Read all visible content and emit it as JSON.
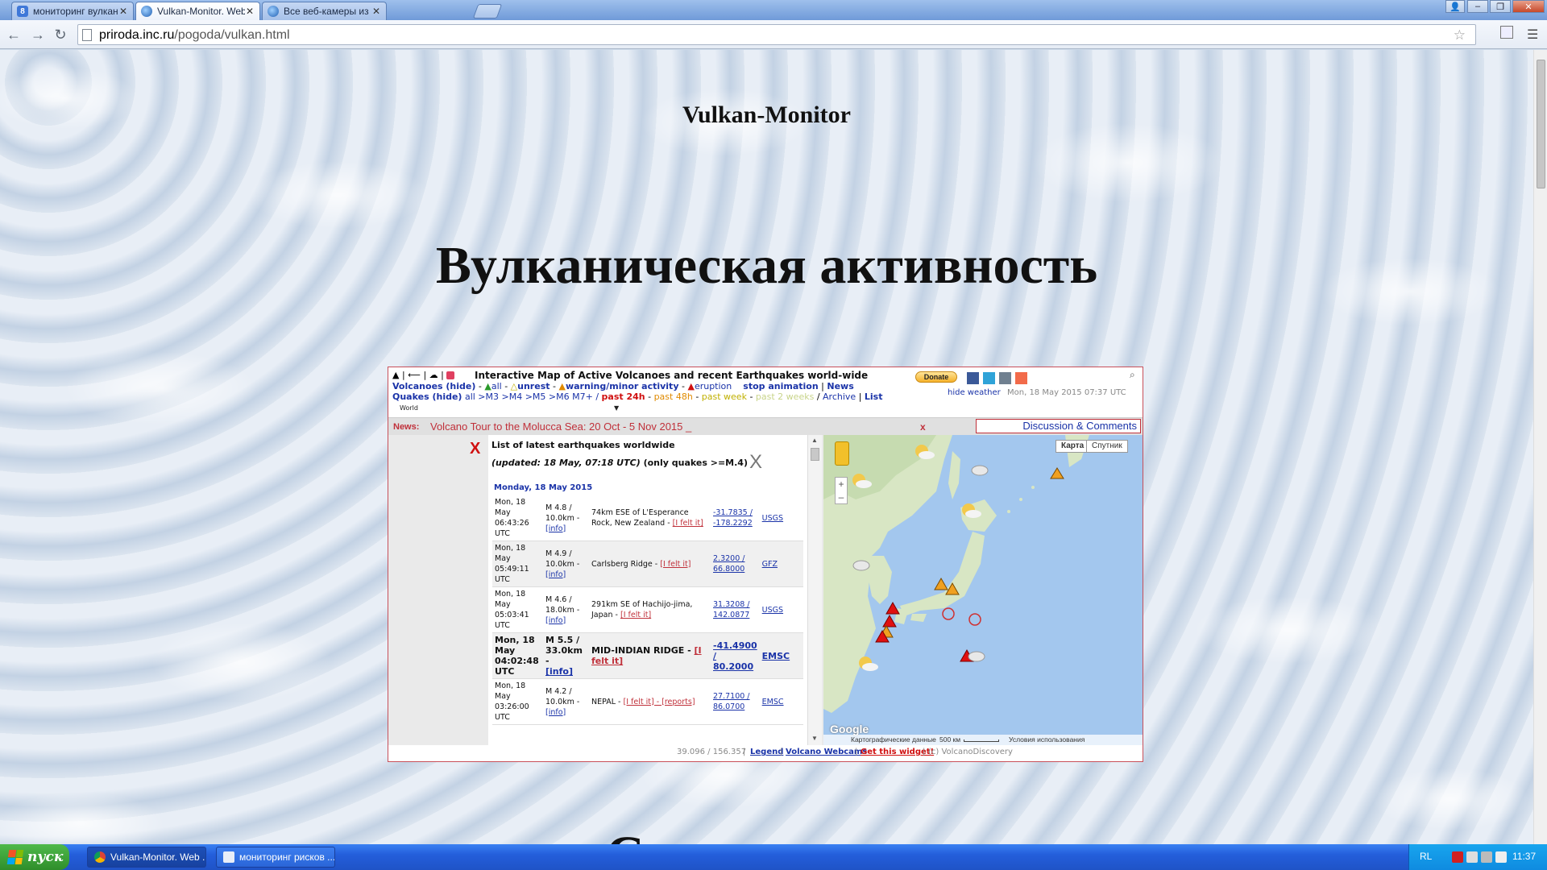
{
  "browser": {
    "tabs": [
      {
        "title": "мониторинг вулканов - По",
        "close": "✕",
        "favicon_letter": "8",
        "active": false
      },
      {
        "title": "Vulkan-Monitor. Web камер",
        "close": "✕",
        "favicon_letter": "",
        "active": true
      },
      {
        "title": "Все веб-камеры из катего",
        "close": "✕",
        "favicon_letter": "",
        "active": false
      }
    ],
    "url_host": "priroda.inc.ru",
    "url_path": "/pogoda/vulkan.html",
    "window_buttons": {
      "user": "👤",
      "minimize": "–",
      "restore": "❐",
      "close": "✕"
    }
  },
  "page": {
    "site_title": "Vulkan-Monitor",
    "heading": "Вулканическая активность",
    "next_heading_fragment": "С"
  },
  "widget": {
    "toolbar_icons": "| ⟵ | ☁ |",
    "title": "Interactive Map of Active Volcanoes and recent Earthquakes world-wide",
    "donate": "Donate",
    "volcanoes_label": "Volcanoes (hide)",
    "filter_all": "all",
    "filter_unrest": "unrest",
    "filter_warning": "warning/minor activity",
    "filter_eruption": "eruption",
    "stop_animation": "stop animation",
    "news_link": "News",
    "quakes_label": "Quakes (hide)",
    "quake_filters": "all >M3 >M4 >M5 >M6 M7+ /",
    "past_24h": "past 24h",
    "past_48h": "past 48h",
    "past_week": "past week",
    "past_2_weeks": "past 2 weeks",
    "archive": "Archive",
    "list": "List",
    "hide_weather": "hide weather",
    "timestamp": "Mon, 18 May 2015 07:37 UTC",
    "world": "World",
    "news_label": "News:",
    "news_text": "Volcano Tour to the Molucca Sea: 20 Oct - 5 Nov 2015 _",
    "news_close": "x",
    "discussion": "Discussion & Comments",
    "list_close_red": "X",
    "list_title": "List of latest earthquakes worldwide",
    "list_updated": "(updated: 18 May, 07:18 UTC)",
    "list_updated_tail": "(only quakes >=M.4)",
    "list_close_grey": "X",
    "list_date": "Monday, 18 May 2015",
    "map_buttons": {
      "map": "Карта",
      "satellite": "Спутник"
    },
    "map_zoom": {
      "in": "+",
      "out": "–"
    },
    "map_attr": {
      "data": "Картографические данные",
      "scale": "500 км",
      "terms": "Условия использования"
    },
    "google": "Google",
    "footer": {
      "coords": "39.096 / 156.357",
      "legend": "Legend",
      "webcams": "Volcano Webcams",
      "widget": "Get this widget!",
      "copyright": "(c) VolcanoDiscovery"
    }
  },
  "quakes": [
    {
      "time": "Mon, 18 May 06:43:26 UTC",
      "mag": "M 4.8 / 10.0km -",
      "info": "[info]",
      "place": "74km ESE of L'Esperance Rock, New Zealand -",
      "felt": "[I felt it]",
      "coords": "-31.7835 / -178.2292",
      "src": "USGS",
      "big": false
    },
    {
      "time": "Mon, 18 May 05:49:11 UTC",
      "mag": "M 4.9 / 10.0km -",
      "info": "[info]",
      "place": "Carlsberg Ridge -",
      "felt": "[I felt it]",
      "coords": "2.3200 / 66.8000",
      "src": "GFZ",
      "big": false
    },
    {
      "time": "Mon, 18 May 05:03:41 UTC",
      "mag": "M 4.6 / 18.0km -",
      "info": "[info]",
      "place": "291km SE of Hachijo-jima, Japan -",
      "felt": "[I felt it]",
      "coords": "31.3208 / 142.0877",
      "src": "USGS",
      "big": false
    },
    {
      "time": "Mon, 18 May 04:02:48 UTC",
      "mag": "M 5.5 / 33.0km -",
      "info": "[info]",
      "place": "MID-INDIAN RIDGE -",
      "felt": "[I felt it]",
      "coords": "-41.4900 / 80.2000",
      "src": "EMSC",
      "big": true
    },
    {
      "time": "Mon, 18 May 03:26:00 UTC",
      "mag": "M 4.2 / 10.0km -",
      "info": "[info]",
      "place": "NEPAL -",
      "felt": "[I felt it] - [reports]",
      "coords": "27.7100 / 86.0700",
      "src": "EMSC",
      "big": false
    }
  ],
  "taskbar": {
    "start": "пуск",
    "tasks": [
      {
        "title": "Vulkan-Monitor. Web ..."
      },
      {
        "title": "мониторинг рисков ..."
      }
    ],
    "lang": "RL",
    "clock": "11:37"
  },
  "colors": {
    "widget_border": "#c8505a",
    "link_blue": "#1a33a8",
    "eruption_red": "#d01010",
    "warning_orange": "#e08a00",
    "taskbar_blue": "#245edb"
  }
}
